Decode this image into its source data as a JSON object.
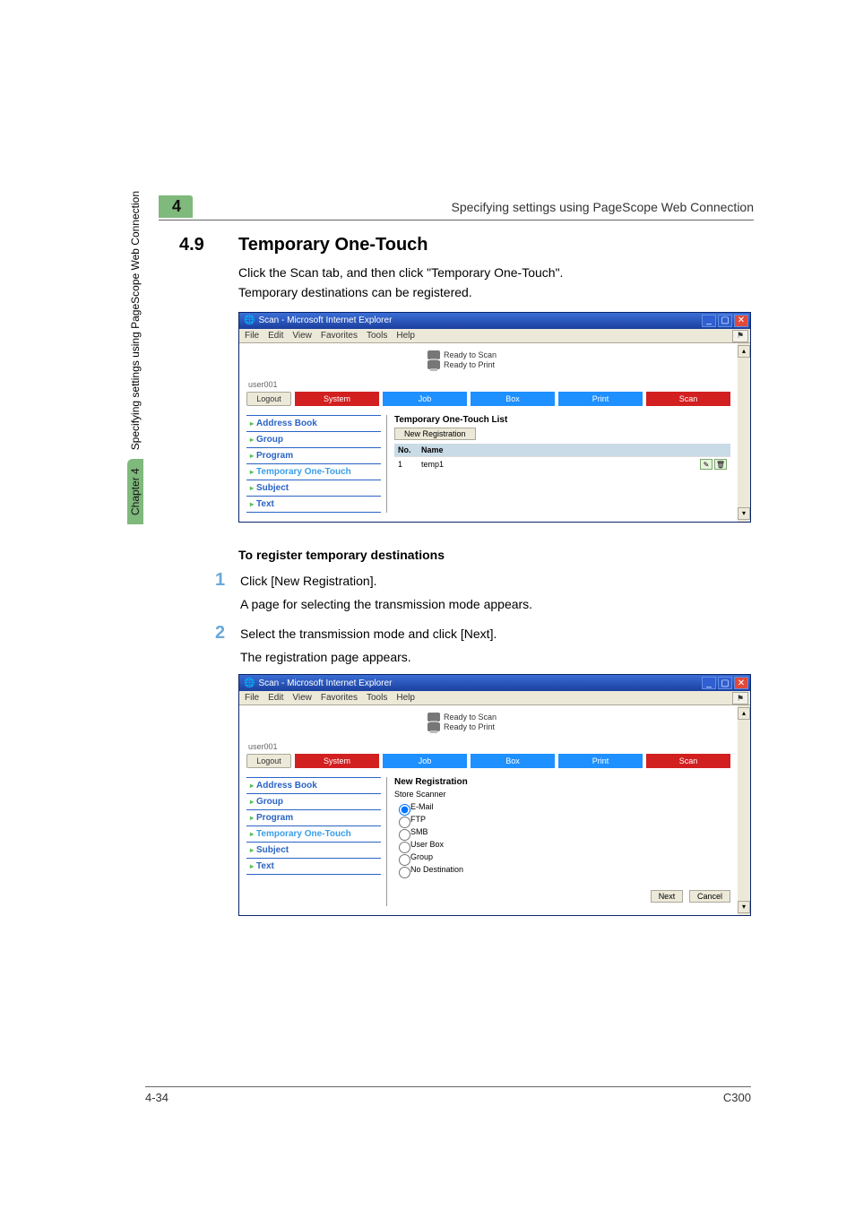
{
  "sidetab": {
    "text": "Specifying settings using PageScope Web Connection",
    "chapter": "Chapter 4"
  },
  "header": {
    "chapter_num": "4",
    "title": "Specifying settings using PageScope Web Connection"
  },
  "section": {
    "num": "4.9",
    "title": "Temporary One-Touch",
    "intro1": "Click the Scan tab, and then click \"Temporary One-Touch\".",
    "intro2": "Temporary destinations can be registered."
  },
  "ie1": {
    "title": "Scan - Microsoft Internet Explorer",
    "menus": [
      "File",
      "Edit",
      "View",
      "Favorites",
      "Tools",
      "Help"
    ],
    "status": {
      "scan": "Ready to Scan",
      "print": "Ready to Print"
    },
    "user": "user001",
    "tabs": {
      "logout": "Logout",
      "system": "System",
      "job": "Job",
      "box": "Box",
      "print": "Print",
      "scan": "Scan"
    },
    "side": [
      "Address Book",
      "Group",
      "Program",
      "Temporary One-Touch",
      "Subject",
      "Text"
    ],
    "list_title": "Temporary One-Touch List",
    "new_reg_btn": "New Registration",
    "cols": {
      "no": "No.",
      "name": "Name"
    },
    "rows": [
      {
        "no": "1",
        "name": "temp1"
      }
    ]
  },
  "sub": {
    "heading": "To register temporary destinations"
  },
  "steps": {
    "s1": {
      "num": "1",
      "text": "Click [New Registration].",
      "desc": "A page for selecting the transmission mode appears."
    },
    "s2": {
      "num": "2",
      "text": "Select the transmission mode and click [Next].",
      "desc": "The registration page appears."
    }
  },
  "ie2": {
    "title": "Scan - Microsoft Internet Explorer",
    "menus": [
      "File",
      "Edit",
      "View",
      "Favorites",
      "Tools",
      "Help"
    ],
    "status": {
      "scan": "Ready to Scan",
      "print": "Ready to Print"
    },
    "user": "user001",
    "tabs": {
      "logout": "Logout",
      "system": "System",
      "job": "Job",
      "box": "Box",
      "print": "Print",
      "scan": "Scan"
    },
    "side": [
      "Address Book",
      "Group",
      "Program",
      "Temporary One-Touch",
      "Subject",
      "Text"
    ],
    "reg_title": "New Registration",
    "store": "Store Scanner",
    "options": [
      "E-Mail",
      "FTP",
      "SMB",
      "User Box",
      "Group",
      "No Destination"
    ],
    "btn_next": "Next",
    "btn_cancel": "Cancel"
  },
  "footer": {
    "left": "4-34",
    "right": "C300"
  }
}
